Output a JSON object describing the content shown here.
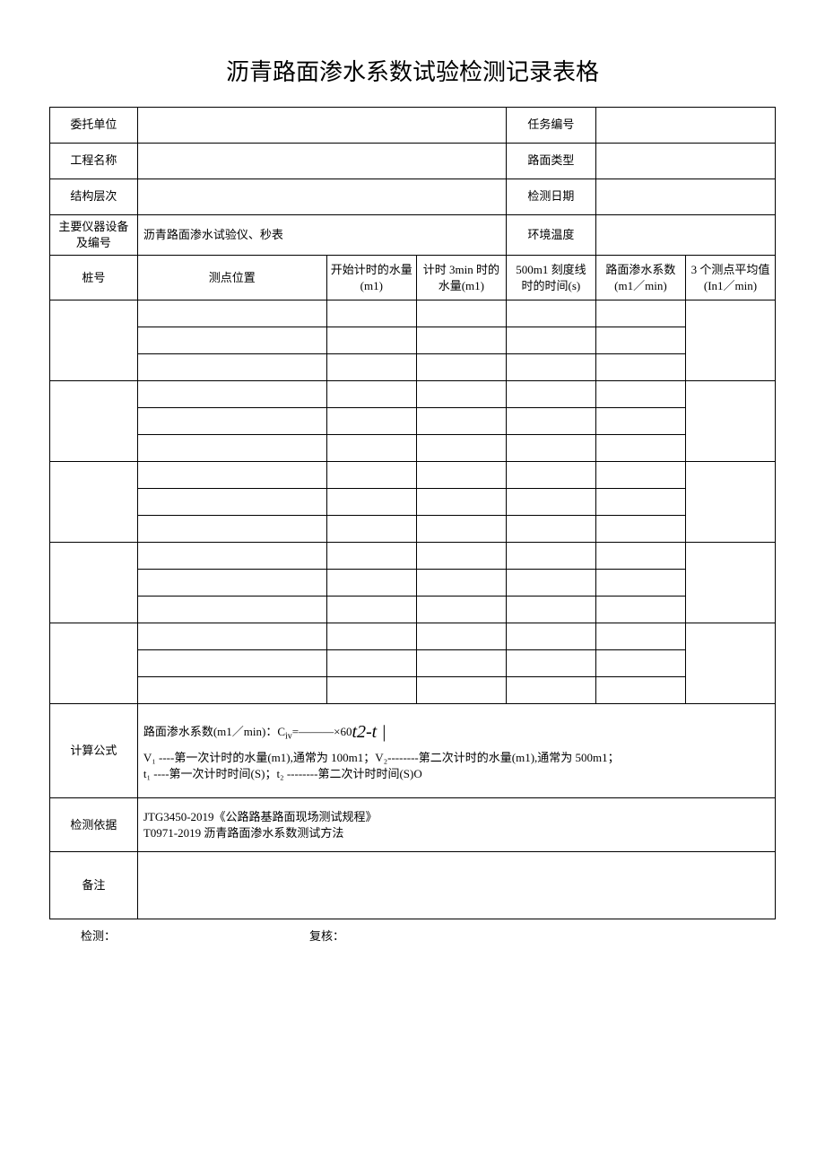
{
  "title": "沥青路面渗水系数试验检测记录表格",
  "labels": {
    "client": "委托单位",
    "task_no": "任务编号",
    "project": "工程名称",
    "pavement_type": "路面类型",
    "structure": "结构层次",
    "test_date": "检测日期",
    "equipment": "主要仪器设备及编号",
    "env_temp": "环境温度",
    "stake": "桩号",
    "point_loc": "测点位置",
    "col_water_start": "开始计时的水量(m1)",
    "col_water_3min": "计时 3min 时的水量(m1)",
    "col_time_500": "500m1 刻度线时的时间(s)",
    "col_coef": "路面渗水系数(m1／min)",
    "col_avg3": "3 个测点平均值(In1／min)",
    "formula_label": "计算公式",
    "basis_label": "检测依据",
    "remark_label": "备注",
    "inspect": "检测：",
    "review": "复核："
  },
  "values": {
    "client": "",
    "task_no": "",
    "project": "",
    "pavement_type": "",
    "structure": "",
    "test_date": "",
    "equipment": "沥青路面渗水试验仪、秒表",
    "env_temp": ""
  },
  "formula": {
    "line1_prefix": "路面渗水系数(m1／min)：C",
    "line1_sub": "iv",
    "line1_mid": "=———×60",
    "line1_exp": "t2-t |",
    "line2": "V₁ ----第一次计时的水量(m1),通常为 100m1；V₂--------第二次计时的水量(m1),通常为 500m1；",
    "line3": "t₁ ----第一次计时时间(S)；t₂ --------第二次计时时间(S)O"
  },
  "basis": {
    "line1": "JTG3450-2019《公路路基路面现场测试规程》",
    "line2": "T0971-2019 沥青路面渗水系数测试方法"
  },
  "remark": ""
}
